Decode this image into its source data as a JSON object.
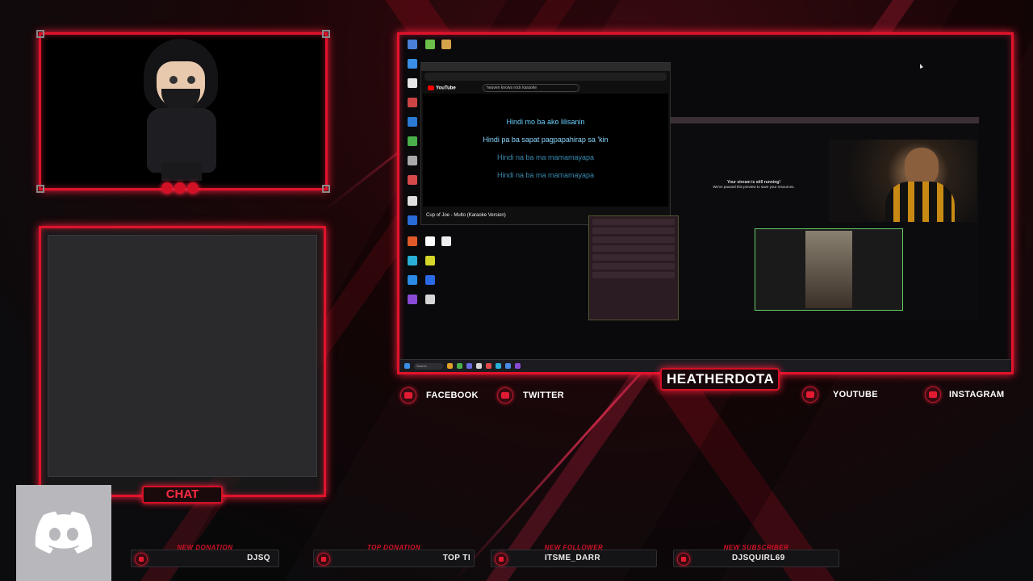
{
  "webcam_panel": {
    "dots": 3
  },
  "chat": {
    "label": "CHAT"
  },
  "discord": {
    "icon": "discord-icon",
    "color": "#ffffff"
  },
  "screen_share": {
    "youtube": {
      "search_query": "heaven knows rock karaoke",
      "video_title": "Cup of Joe - Multo (Karaoke Version)",
      "lyrics": [
        "Hindi mo ba ako lilisanin",
        "Hindi pa ba sapat pagpapahirap sa 'kin",
        "Hindi na ba ma mamamayapa",
        "Hindi na ba ma mamamayapa"
      ]
    },
    "stream_notice": {
      "title": "Your stream is still running!",
      "subtitle": "We've paused this preview to save your resources."
    },
    "taskbar": {
      "search_placeholder": "Search"
    }
  },
  "streamer": {
    "name": "HEATHERDOTA"
  },
  "socials": {
    "facebook": "FACEBOOK",
    "twitter": "TWITTER",
    "youtube": "YOUTUBE",
    "instagram": "INSTAGRAM"
  },
  "alerts": {
    "new_donation": {
      "label": "NEW DONATION",
      "value": "DJSQ"
    },
    "top_donation": {
      "label": "TOP DONATION",
      "value": "TOP TI"
    },
    "new_follower": {
      "label": "NEW FOLLOWER",
      "value": "ITSME_DARR"
    },
    "new_subscriber": {
      "label": "NEW SUBSCRIBER",
      "value": "DJSQUIRL69"
    }
  },
  "colors": {
    "accent": "#e0132b",
    "glow": "#ff1e3c",
    "background": "#0c0b0d"
  }
}
